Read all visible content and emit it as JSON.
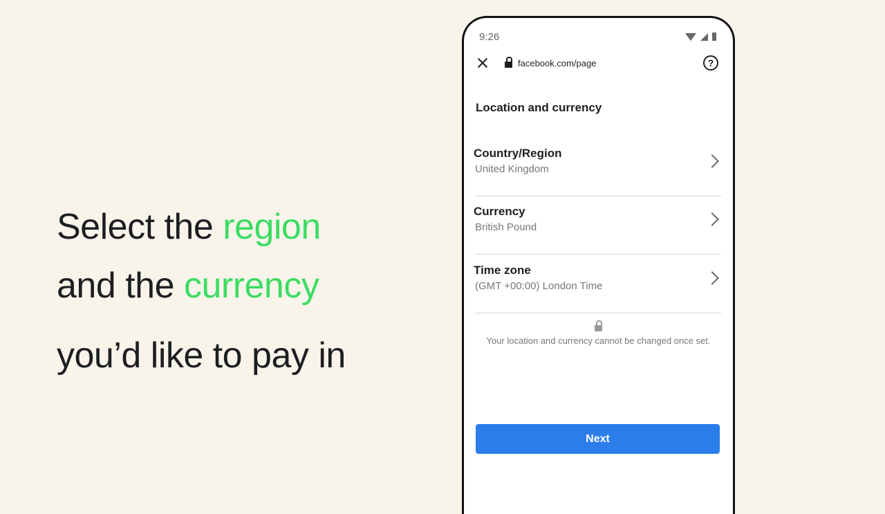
{
  "caption": {
    "line1_plain": "Select the",
    "line1_highlight": "region",
    "line2_plain": "and the",
    "line2_highlight": "currency",
    "line3": "you’d like to pay in",
    "highlight_color": "#3ddc63"
  },
  "phone": {
    "status_time": "9:26",
    "url": "facebook.com/page",
    "page_title": "Location and currency",
    "rows": [
      {
        "label": "Country/Region",
        "value": "United Kingdom"
      },
      {
        "label": "Currency",
        "value": "British Pound"
      },
      {
        "label": "Time zone",
        "value": "(GMT +00:00) London Time"
      }
    ],
    "note": "Your location and currency cannot be changed once set.",
    "next_label": "Next",
    "accent_color": "#2b7de9"
  }
}
